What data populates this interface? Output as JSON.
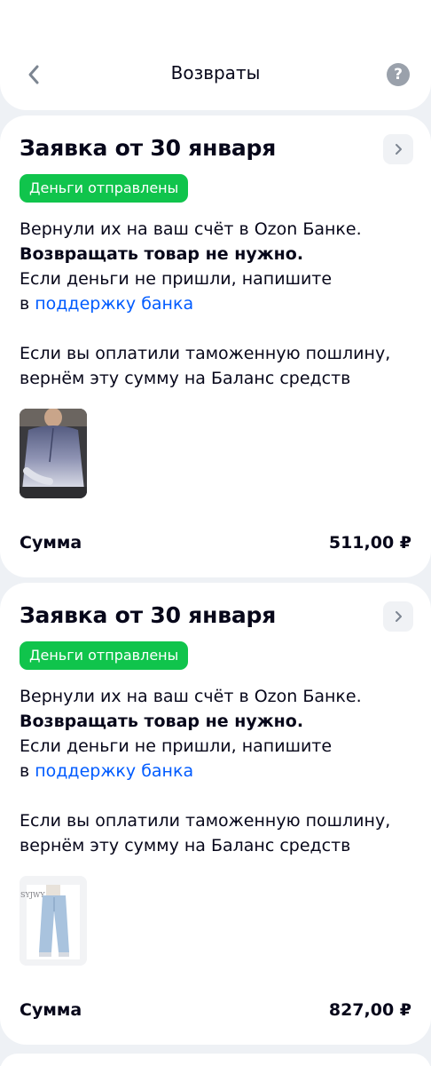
{
  "header": {
    "title": "Возвраты",
    "help_symbol": "?"
  },
  "returns": [
    {
      "title": "Заявка от 30 января",
      "status": "Деньги отправлены",
      "line1": "Вернули их на ваш счёт в Ozon Банке.",
      "line2": "Возвращать товар не нужно.",
      "line3": "Если деньги не пришли, напишите",
      "line4_prefix": "в",
      "line4_link": "поддержку банка",
      "line5": "Если вы оплатили таможенную пошлину,",
      "line6": "вернём эту сумму на Баланс средств",
      "product": "blouse",
      "sum_label": "Сумма",
      "sum_value": "511,00 ₽"
    },
    {
      "title": "Заявка от 30 января",
      "status": "Деньги отправлены",
      "line1": "Вернули их на ваш счёт в Ozon Банке.",
      "line2": "Возвращать товар не нужно.",
      "line3": "Если деньги не пришли, напишите",
      "line4_prefix": "в",
      "line4_link": "поддержку банка",
      "line5": "Если вы оплатили таможенную пошлину,",
      "line6": "вернём эту сумму на Баланс средств",
      "product": "jeans",
      "product_brand": "SYJWY",
      "sum_label": "Сумма",
      "sum_value": "827,00 ₽"
    }
  ],
  "colors": {
    "background": "#eef1f5",
    "card": "#ffffff",
    "badge": "#10c44c",
    "link": "#005bff",
    "text": "#07071a"
  }
}
